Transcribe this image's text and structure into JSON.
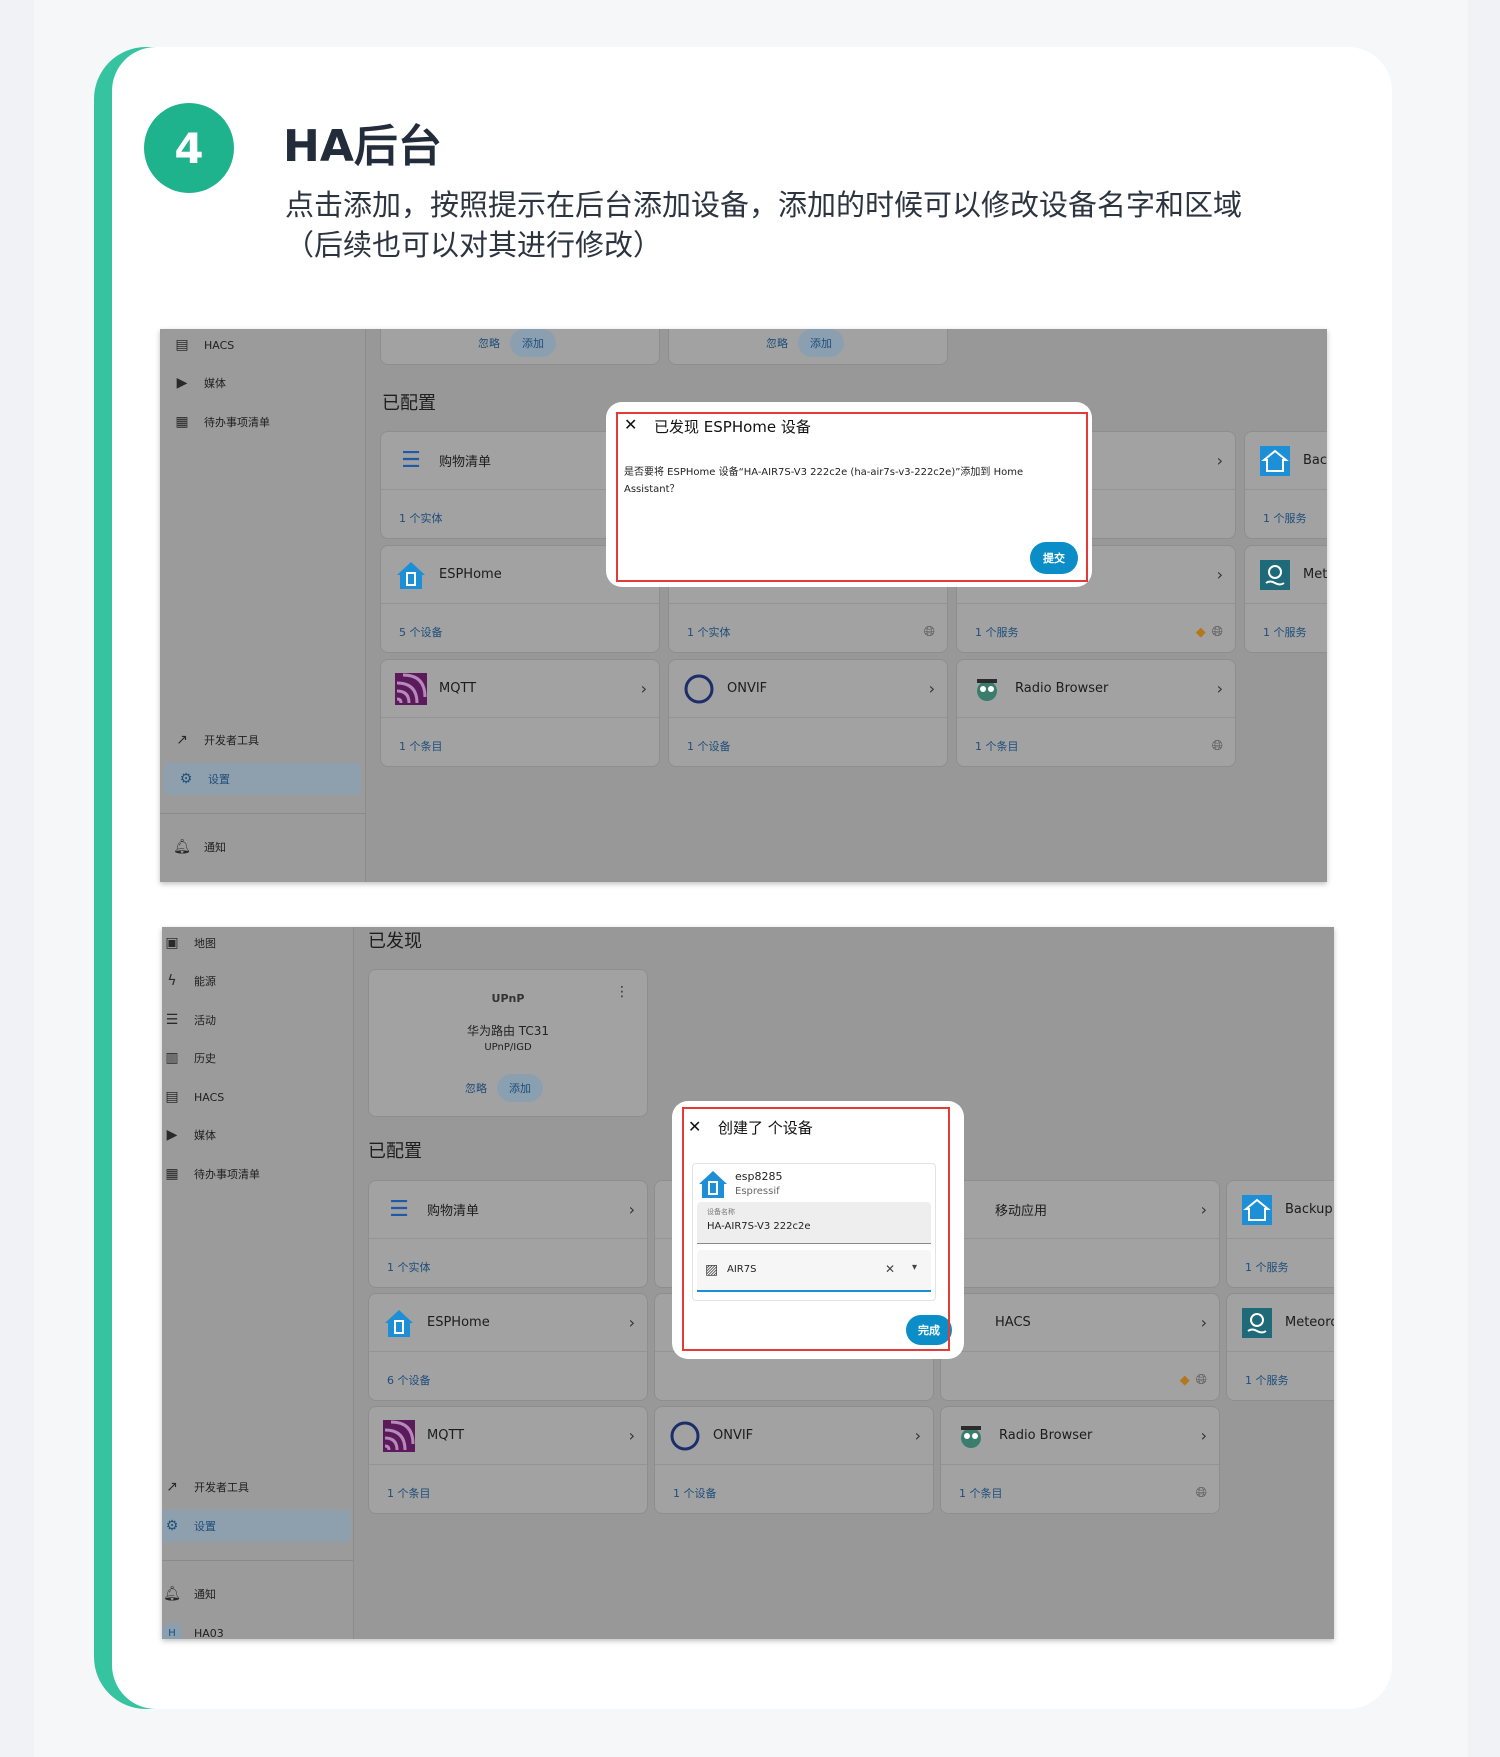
{
  "step": {
    "number": "4",
    "title": "HA后台",
    "description": "点击添加，按照提示在后台添加设备，添加的时候可以修改设备名字和区域（后续也可以对其进行修改）"
  },
  "shot1": {
    "sidebar": {
      "items": [
        "HACS",
        "媒体",
        "待办事项清单"
      ],
      "bottom_items": [
        "开发者工具",
        "设置"
      ],
      "notification": "通知"
    },
    "discovered_buttons": {
      "ignore": "忽略",
      "add": "添加"
    },
    "section_configured": "已配置",
    "cards": [
      {
        "name": "购物清单",
        "stat": "1 个实体"
      },
      {
        "name": "ESPHome",
        "stat": "5 个设备"
      },
      {
        "name": "MQTT",
        "stat": "1 个条目"
      },
      {
        "name": "",
        "stat": "1 个实体"
      },
      {
        "name": "ONVIF",
        "stat": "1 个设备"
      },
      {
        "name": "",
        "stat": "1 个服务"
      },
      {
        "name": "Radio Browser",
        "stat": "1 个条目"
      },
      {
        "name": "Bacl",
        "stat": "1 个服务"
      },
      {
        "name": "Met",
        "stat": "1 个服务"
      }
    ],
    "dialog": {
      "title": "已发现 ESPHome 设备",
      "message": "是否要将 ESPHome 设备“HA-AIR7S-V3 222c2e (ha-air7s-v3-222c2e)”添加到 Home Assistant？",
      "submit": "提交"
    }
  },
  "shot2": {
    "sidebar": {
      "items": [
        "地图",
        "能源",
        "活动",
        "历史",
        "HACS",
        "媒体",
        "待办事项清单"
      ],
      "bottom_items": [
        "开发者工具",
        "设置"
      ],
      "notification": "通知",
      "user_initial": "H",
      "user": "HA03"
    },
    "section_discovered": "已发现",
    "discovered_card": {
      "title": "UPnP",
      "device": "华为路由 TC31",
      "type": "UPnP/IGD",
      "ignore": "忽略",
      "add": "添加"
    },
    "section_configured": "已配置",
    "cards": [
      {
        "name": "购物清单",
        "stat": "1 个实体"
      },
      {
        "name": "ESPHome",
        "stat": "6 个设备"
      },
      {
        "name": "MQTT",
        "stat": "1 个条目"
      },
      {
        "name": "ONVIF",
        "stat": "1 个设备"
      },
      {
        "name": "移动应用",
        "stat": ""
      },
      {
        "name": "HACS",
        "stat": ""
      },
      {
        "name": "Radio Browser",
        "stat": "1 个条目"
      },
      {
        "name": "Backup",
        "stat": "1 个服务"
      },
      {
        "name": "Meteoro",
        "stat": "1 个服务"
      }
    ],
    "dialog": {
      "title": "创建了 个设备",
      "device_name": "esp8285",
      "manufacturer": "Espressif",
      "name_field_label": "设备名称",
      "name_field_value": "HA-AIR7S-V3 222c2e",
      "area_value": "AIR7S",
      "finish": "完成"
    }
  }
}
